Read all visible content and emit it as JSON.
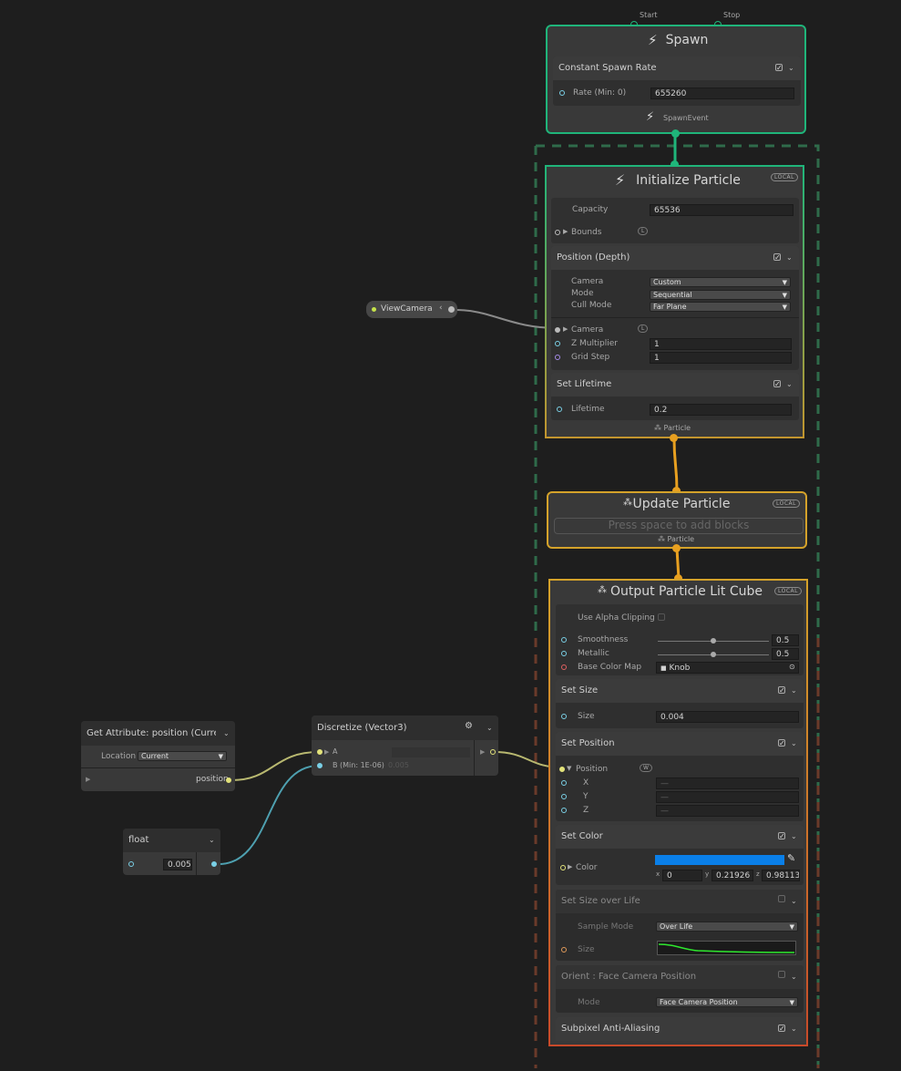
{
  "spawn": {
    "title": "Spawn",
    "start_label": "Start",
    "stop_label": "Stop",
    "block_title": "Constant Spawn Rate",
    "rate_label": "Rate (Min: 0)",
    "rate_value": "655260",
    "output_label": "SpawnEvent"
  },
  "init": {
    "title": "Initialize Particle",
    "badge": "LOCAL",
    "capacity_label": "Capacity",
    "capacity_value": "65536",
    "bounds_label": "Bounds",
    "bounds_badge": "L",
    "position_block": "Position (Depth)",
    "camera_label": "Camera",
    "camera_value": "Custom",
    "mode_label": "Mode",
    "mode_value": "Sequential",
    "cull_label": "Cull Mode",
    "cull_value": "Far Plane",
    "camera_port_label": "Camera",
    "camera_port_badge": "L",
    "zmult_label": "Z Multiplier",
    "zmult_value": "1",
    "grid_label": "Grid Step",
    "grid_value": "1",
    "lifetime_block": "Set Lifetime",
    "lifetime_label": "Lifetime",
    "lifetime_value": "0.2",
    "output_label": "Particle"
  },
  "update": {
    "title": "Update Particle",
    "badge": "LOCAL",
    "placeholder": "Press space to add blocks",
    "output_label": "Particle"
  },
  "output": {
    "title": "Output Particle Lit Cube",
    "badge": "LOCAL",
    "alpha_label": "Use Alpha Clipping",
    "smooth_label": "Smoothness",
    "smooth_value": "0.5",
    "metal_label": "Metallic",
    "metal_value": "0.5",
    "basecolor_label": "Base Color Map",
    "basecolor_value": "Knob",
    "size_block": "Set Size",
    "size_label": "Size",
    "size_value": "0.004",
    "setpos_block": "Set Position",
    "pos_label": "Position",
    "pos_badge": "W",
    "x_label": "X",
    "y_label": "Y",
    "z_label": "Z",
    "dash": "—",
    "setcolor_block": "Set Color",
    "color_label": "Color",
    "color_hex": "#0a7fe8",
    "cx_label": "x",
    "cx_value": "0",
    "cy_label": "y",
    "cy_value": "0.21926",
    "cz_label": "z",
    "cz_value": "0.98113",
    "sizelife_block": "Set Size over Life",
    "sample_label": "Sample Mode",
    "sample_value": "Over Life",
    "sizecurve_label": "Size",
    "orient_block": "Orient : Face Camera Position",
    "orient_mode_label": "Mode",
    "orient_mode_value": "Face Camera Position",
    "aa_block": "Subpixel Anti-Aliasing"
  },
  "viewcamera": {
    "label": "ViewCamera"
  },
  "getattr": {
    "title": "Get Attribute: position (Current",
    "location_label": "Location",
    "location_value": "Current",
    "output_label": "position"
  },
  "floatnode": {
    "title": "float",
    "value": "0.005"
  },
  "discretize": {
    "title": "Discretize (Vector3)",
    "a_label": "A",
    "b_label": "B (Min: 1E-06)",
    "b_value": "0.005"
  },
  "colors": {
    "spawn_border": "#1fb57a",
    "init_border": "#c2952e",
    "update_border": "#d4a22a",
    "output_border": "#c98a2a",
    "system_dash": "#2f6b4a"
  }
}
